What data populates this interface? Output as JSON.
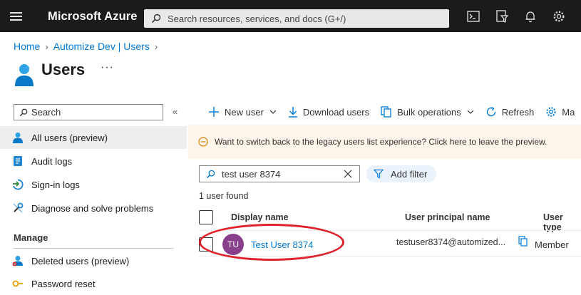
{
  "topbar": {
    "brand": "Microsoft Azure",
    "search_placeholder": "Search resources, services, and docs (G+/)",
    "icons": [
      "menu-icon",
      "cloud-shell-icon",
      "directory-filter-icon",
      "notifications-icon",
      "settings-icon"
    ]
  },
  "breadcrumb": {
    "items": [
      "Home",
      "Automize Dev | Users"
    ]
  },
  "header": {
    "title": "Users",
    "more": "···"
  },
  "sidebar": {
    "search_placeholder": "Search",
    "collapse": "«",
    "items": [
      {
        "label": "All users (preview)",
        "icon": "user-icon",
        "active": true
      },
      {
        "label": "Audit logs",
        "icon": "audit-log-icon"
      },
      {
        "label": "Sign-in logs",
        "icon": "sign-in-icon"
      },
      {
        "label": "Diagnose and solve problems",
        "icon": "wrench-icon"
      }
    ],
    "section_manage": "Manage",
    "manage_items": [
      {
        "label": "Deleted users (preview)",
        "icon": "deleted-user-icon"
      },
      {
        "label": "Password reset",
        "icon": "key-icon"
      }
    ]
  },
  "toolbar": {
    "new_user": "New user",
    "download_users": "Download users",
    "bulk_operations": "Bulk operations",
    "refresh": "Refresh",
    "manage": "Ma"
  },
  "banner": {
    "text": "Want to switch back to the legacy users list experience? Click here to leave the preview."
  },
  "filter": {
    "search_value": "test user 8374",
    "add_filter": "Add filter",
    "result_count": "1 user found"
  },
  "table": {
    "columns": [
      "Display name",
      "User principal name",
      "User type"
    ],
    "rows": [
      {
        "initials": "TU",
        "display_name": "Test User 8374",
        "upn": "testuser8374@automized...",
        "user_type": "Member"
      }
    ]
  },
  "colors": {
    "topbar_bg": "#1b1b1b",
    "link": "#0078d4",
    "avatar": "#8a3f8d",
    "banner_bg": "#fdf4ea",
    "highlight_circle": "#e0202a"
  }
}
